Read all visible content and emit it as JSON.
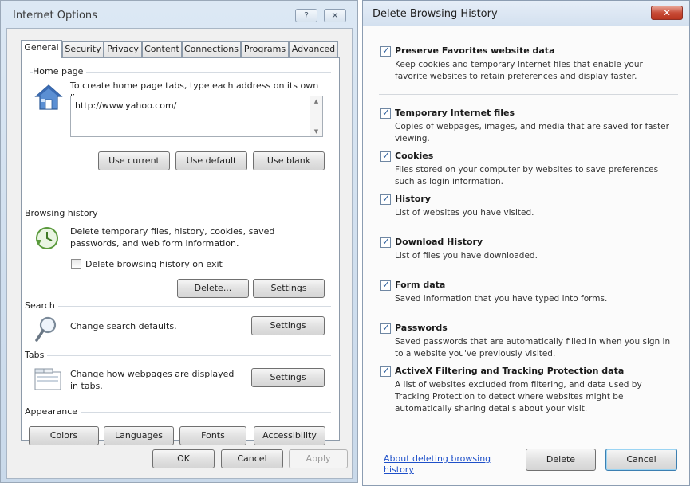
{
  "internet_options": {
    "title": "Internet Options",
    "help_label": "?",
    "close_label": "✕",
    "tabs": [
      {
        "label": "General",
        "active": true
      },
      {
        "label": "Security"
      },
      {
        "label": "Privacy"
      },
      {
        "label": "Content"
      },
      {
        "label": "Connections"
      },
      {
        "label": "Programs"
      },
      {
        "label": "Advanced"
      }
    ],
    "home_page": {
      "heading": "Home page",
      "description": "To create home page tabs, type each address on its own line.",
      "value": "http://www.yahoo.com/",
      "use_current": "Use current",
      "use_default": "Use default",
      "use_blank": "Use blank"
    },
    "browsing_history": {
      "heading": "Browsing history",
      "description": "Delete temporary files, history, cookies, saved passwords, and web form information.",
      "delete_on_exit_label": "Delete browsing history on exit",
      "delete_on_exit_checked": false,
      "delete_button": "Delete...",
      "settings_button": "Settings"
    },
    "search": {
      "heading": "Search",
      "description": "Change search defaults.",
      "settings_button": "Settings"
    },
    "tabs_group": {
      "heading": "Tabs",
      "description": "Change how webpages are displayed in tabs.",
      "settings_button": "Settings"
    },
    "appearance": {
      "heading": "Appearance",
      "colors": "Colors",
      "languages": "Languages",
      "fonts": "Fonts",
      "accessibility": "Accessibility"
    },
    "footer": {
      "ok": "OK",
      "cancel": "Cancel",
      "apply": "Apply"
    }
  },
  "delete_history": {
    "title": "Delete Browsing History",
    "close_label": "✕",
    "options": [
      {
        "label": "Preserve Favorites website data",
        "checked": true,
        "description": "Keep cookies and temporary Internet files that enable your favorite websites to retain preferences and display faster."
      },
      {
        "label": "Temporary Internet files",
        "checked": true,
        "description": "Copies of webpages, images, and media that are saved for faster viewing."
      },
      {
        "label": "Cookies",
        "checked": true,
        "description": "Files stored on your computer by websites to save preferences such as login information."
      },
      {
        "label": "History",
        "checked": true,
        "description": "List of websites you have visited."
      },
      {
        "label": "Download History",
        "checked": true,
        "description": "List of files you have downloaded."
      },
      {
        "label": "Form data",
        "checked": true,
        "description": "Saved information that you have typed into forms."
      },
      {
        "label": "Passwords",
        "checked": true,
        "description": "Saved passwords that are automatically filled in when you sign in to a website you've previously visited."
      },
      {
        "label": "ActiveX Filtering and Tracking Protection data",
        "checked": true,
        "description": "A list of websites excluded from filtering, and data used by Tracking Protection to detect where websites might be automatically sharing details about your visit."
      }
    ],
    "link": "About deleting browsing history",
    "delete_button": "Delete",
    "cancel_button": "Cancel"
  }
}
